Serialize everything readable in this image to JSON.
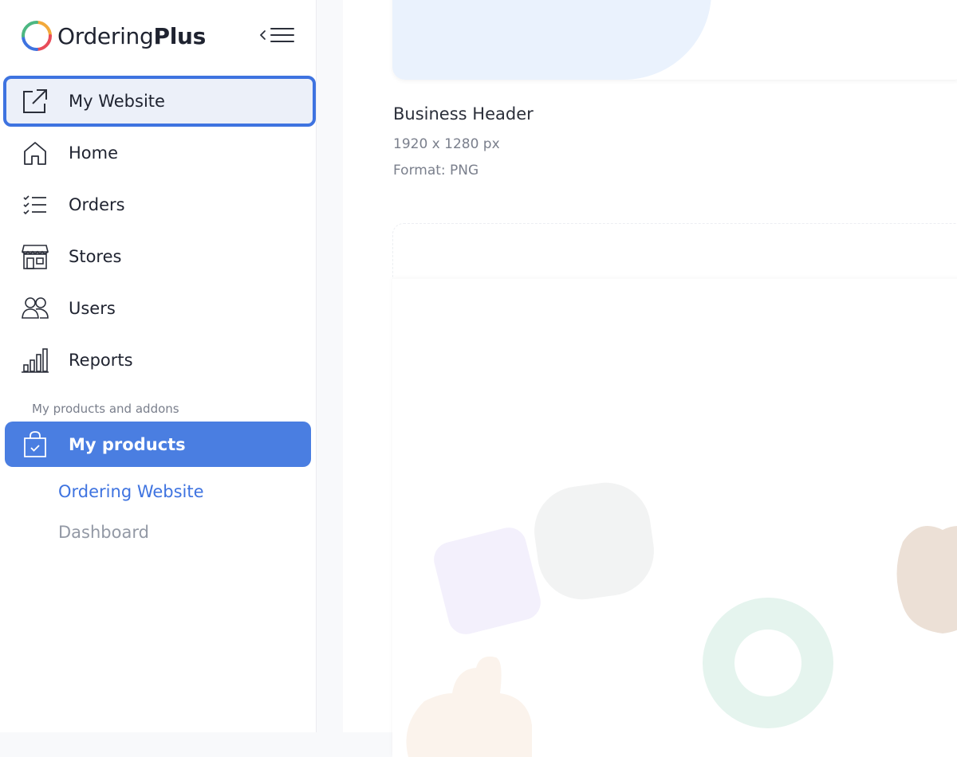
{
  "brand": {
    "name_regular": "Ordering",
    "name_bold": "Plus"
  },
  "sidebar": {
    "items": [
      {
        "label": "My Website",
        "icon": "external-link-icon"
      },
      {
        "label": "Home",
        "icon": "home-icon"
      },
      {
        "label": "Orders",
        "icon": "list-check-icon"
      },
      {
        "label": "Stores",
        "icon": "store-icon"
      },
      {
        "label": "Users",
        "icon": "users-icon"
      },
      {
        "label": "Reports",
        "icon": "bar-chart-icon"
      }
    ],
    "section_label": "My products and addons",
    "products": {
      "label": "My products",
      "icon": "shopping-bag-check-icon"
    },
    "subitems": [
      {
        "label": "Ordering Website"
      },
      {
        "label": "Dashboard"
      }
    ]
  },
  "main": {
    "image_title": "Business Header",
    "image_size": "1920 x 1280 px",
    "image_format": "Format: PNG"
  },
  "colors": {
    "accent": "#4a7ee1",
    "focus_border": "#3e73e0",
    "active_link": "#3e73e0"
  }
}
